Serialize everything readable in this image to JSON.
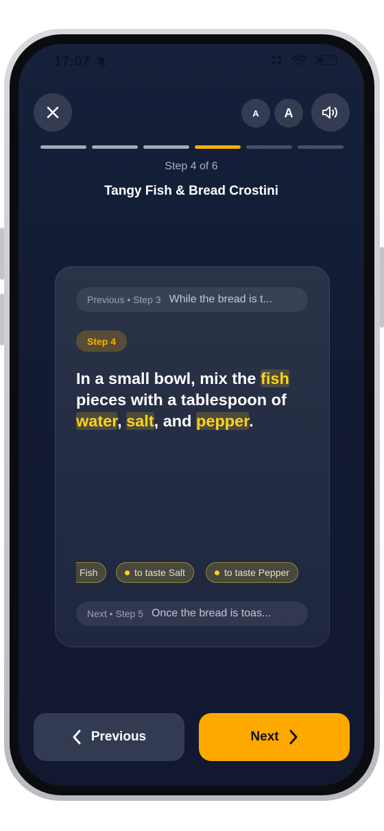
{
  "status_bar": {
    "time": "17:07"
  },
  "controls": {
    "font_small": "A",
    "font_large": "A"
  },
  "progress": {
    "total_steps": 6,
    "current_step": 4
  },
  "header": {
    "step_counter": "Step 4 of 6",
    "recipe_title": "Tangy Fish & Bread Crostini"
  },
  "card": {
    "previous": {
      "meta": "Previous • Step 3",
      "text": "While the bread is t..."
    },
    "step_badge": "Step 4",
    "instruction": [
      {
        "text": "In a small bowl, mix the ",
        "highlight": false
      },
      {
        "text": "fish",
        "highlight": true
      },
      {
        "text": " pieces with a tablespoon of ",
        "highlight": false
      },
      {
        "text": "water",
        "highlight": true
      },
      {
        "text": ", ",
        "highlight": false
      },
      {
        "text": "salt",
        "highlight": true
      },
      {
        "text": ", and ",
        "highlight": false
      },
      {
        "text": "pepper",
        "highlight": true
      },
      {
        "text": ".",
        "highlight": false
      }
    ],
    "ingredients": [
      {
        "label": "Fish",
        "partial": true
      },
      {
        "label": "to taste Salt",
        "partial": false
      },
      {
        "label": "to taste Pepper",
        "partial": false
      }
    ],
    "next": {
      "meta": "Next • Step 5",
      "text": "Once the bread is toas..."
    }
  },
  "nav": {
    "previous_label": "Previous",
    "next_label": "Next"
  },
  "colors": {
    "accent": "#ffa800",
    "highlight": "#ffd21c",
    "background": "#131b33"
  }
}
